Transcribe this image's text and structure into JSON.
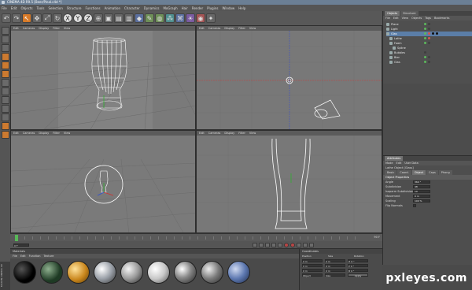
{
  "window": {
    "title": "CINEMA 4D R9.5 [Beer/Pinal.c4d *]"
  },
  "menubar": {
    "items": [
      "File",
      "Edit",
      "Objects",
      "Tools",
      "Selection",
      "Structure",
      "Functions",
      "Animation",
      "Character",
      "Dynamics",
      "MoGraph",
      "Hair",
      "Render",
      "Plugins",
      "Window",
      "Help"
    ]
  },
  "viewports": {
    "menu": [
      "Edit",
      "Cameras",
      "Display",
      "Filter",
      "View"
    ],
    "perspective_top": "Perspective",
    "top": "Top",
    "perspective_bottom": "Perspective",
    "front": "Front"
  },
  "objectmanager": {
    "tabs": [
      "Objects",
      "Structure"
    ],
    "menu": [
      "File",
      "Edit",
      "View",
      "Objects",
      "Tags",
      "Bookmarks"
    ],
    "rows": [
      {
        "name": "Plane"
      },
      {
        "name": "Light"
      },
      {
        "name": "Glas"
      },
      {
        "name": "Lathe"
      },
      {
        "name": "Foam"
      },
      {
        "name": "Spline"
      },
      {
        "name": "Bubbles"
      },
      {
        "name": "Bier"
      },
      {
        "name": "Glas"
      }
    ]
  },
  "attributes": {
    "header": "Attributes",
    "menu": [
      "Mode",
      "Edit",
      "User Data"
    ],
    "object_title": "Lathe Object [Glass]",
    "tabs": [
      "Basic",
      "Coord.",
      "Object",
      "Caps",
      "Phong"
    ],
    "section_title": "Object Properties",
    "fields": [
      {
        "label": "Angle",
        "value": "360 °"
      },
      {
        "label": "Subdivision",
        "value": "48"
      },
      {
        "label": "Isoparm Subdivision",
        "value": "10"
      },
      {
        "label": "Movement",
        "value": "0 m"
      },
      {
        "label": "Scaling",
        "value": "100 %"
      },
      {
        "label": "Flip Normals",
        "value": ""
      }
    ]
  },
  "timeline": {
    "frame_left": "0 F",
    "frame_right": "90 F"
  },
  "materials": {
    "header": "Materials",
    "menu": [
      "File",
      "Edit",
      "Function",
      "Texture"
    ]
  },
  "coordinates": {
    "header": "Coordinates",
    "columns": [
      "Position",
      "Size",
      "Rotation"
    ],
    "rows": [
      {
        "axis": "X",
        "pos": "0 m",
        "size": "0 m",
        "rot": "H 0 °"
      },
      {
        "axis": "Y",
        "pos": "0 m",
        "size": "0 m",
        "rot": "P 0 °"
      },
      {
        "axis": "Z",
        "pos": "0 m",
        "size": "0 m",
        "rot": "B 0 °"
      }
    ],
    "mode": "Object",
    "size_mode": "Size",
    "apply": "Apply"
  },
  "watermark": "pxleyes.com",
  "sidebar_brand": "MAXON CINEMA 4D",
  "colors": {
    "selection_orange": "#d77a28",
    "viewport_gray": "#747474",
    "axis_red": "#d03030",
    "axis_green": "#30b030",
    "axis_blue": "#3050d0"
  }
}
